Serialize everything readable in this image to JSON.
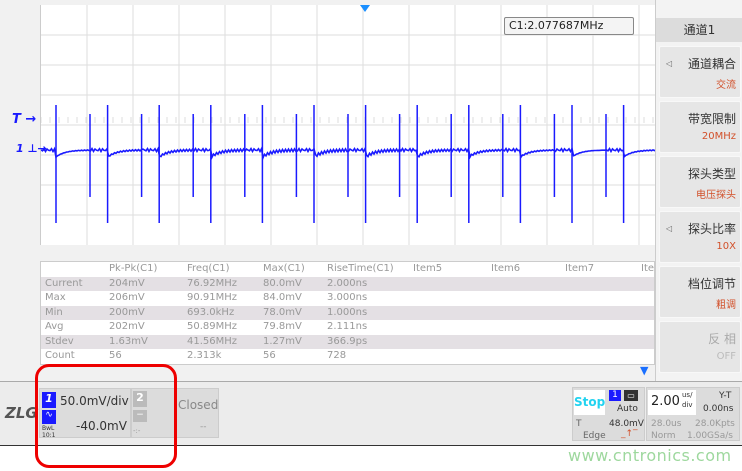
{
  "markers": {
    "trigger": "T →",
    "channel1": "1 ⊥→"
  },
  "freq_readout": "C1:2.077687MHz",
  "measure_table": {
    "headers": [
      "",
      "Pk-Pk(C1)",
      "Freq(C1)",
      "Max(C1)",
      "RiseTime(C1)",
      "Item5",
      "Item6",
      "Item7",
      "Ite"
    ],
    "rows": [
      [
        "Current",
        "204mV",
        "76.92MHz",
        "80.0mV",
        "2.000ns"
      ],
      [
        "Max",
        "206mV",
        "90.91MHz",
        "84.0mV",
        "3.000ns"
      ],
      [
        "Min",
        "200mV",
        "693.0kHz",
        "78.0mV",
        "1.000ns"
      ],
      [
        "Avg",
        "202mV",
        "50.89MHz",
        "79.8mV",
        "2.111ns"
      ],
      [
        "Stdev",
        "1.63mV",
        "41.56MHz",
        "1.27mV",
        "366.9ps"
      ],
      [
        "Count",
        "56",
        "2.313k",
        "56",
        "728"
      ]
    ]
  },
  "side_panel": {
    "title": "通道1",
    "items": [
      {
        "label": "通道耦合",
        "value": "交流",
        "arrow": true
      },
      {
        "label": "带宽限制",
        "value": "20MHz",
        "arrow": false
      },
      {
        "label": "探头类型",
        "value": "电压探头",
        "arrow": false
      },
      {
        "label": "探头比率",
        "value": "10X",
        "arrow": true
      },
      {
        "label": "档位调节",
        "value": "粗调",
        "arrow": false
      },
      {
        "label": "反  相",
        "value": "OFF",
        "arrow": false,
        "disabled": true
      }
    ]
  },
  "bottom": {
    "logo": "ZLG",
    "ch1": {
      "num": "1",
      "scale": "50.0mV/div",
      "offset": "-40.0mV",
      "bw": "BwL",
      "ratio": "10:1"
    },
    "ch2": {
      "num": "2",
      "status": "Closed",
      "coupling": "−",
      "scale": "--",
      "offset": "-:-"
    },
    "run": {
      "state": "Stop",
      "trig_ch": "1",
      "mode": "Auto",
      "level_label": "T",
      "level": "48.0mV",
      "type": "Edge"
    },
    "timebase": {
      "value": "2.00",
      "unit_top": "us/",
      "unit_bot": "div",
      "mode": "Y-T",
      "delay": "0.00ns",
      "window": "28.0us",
      "points": "28.0Kpts",
      "acq": "Norm",
      "rate": "1.00GSa/s"
    }
  },
  "watermark": "www.cntronics.com",
  "colors": {
    "trace": "#1a1aff",
    "accent": "#d2502a",
    "stop": "#22d3f0",
    "annotation": "#e00000"
  }
}
